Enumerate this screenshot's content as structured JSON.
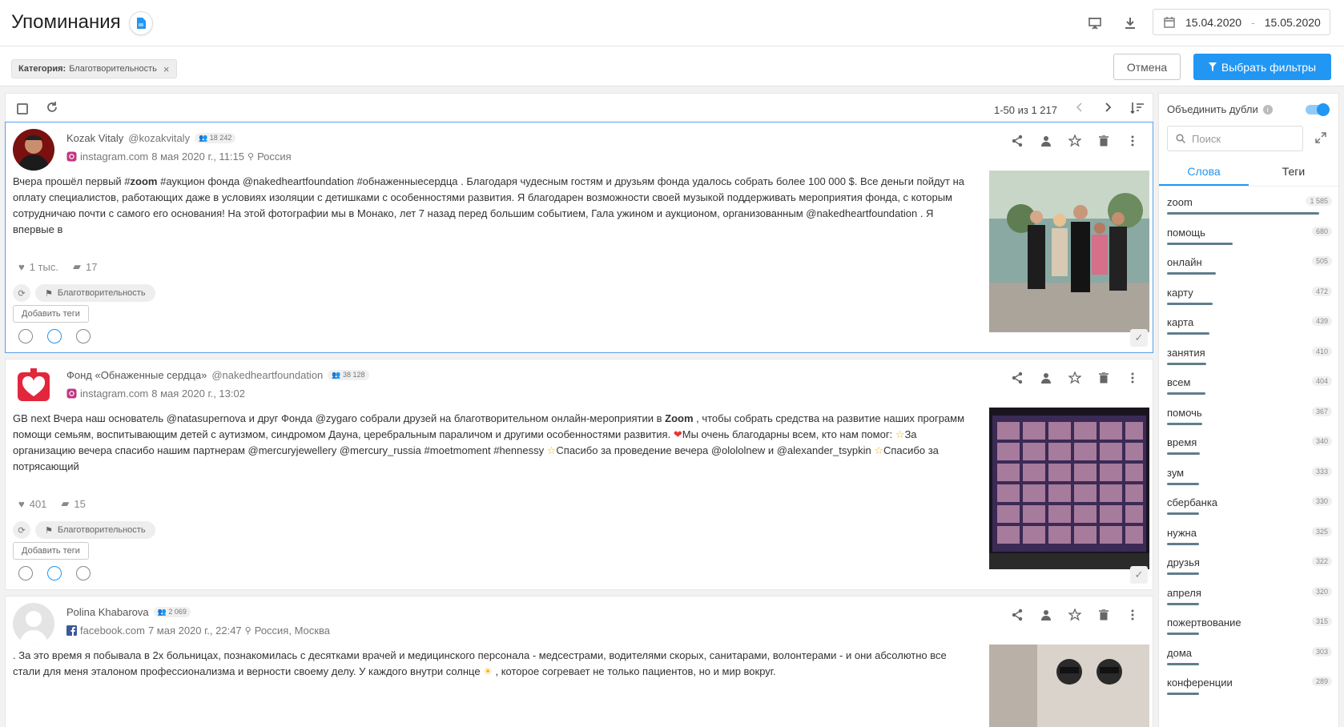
{
  "header": {
    "title": "Упоминания",
    "date_from": "15.04.2020",
    "date_sep": "-",
    "date_to": "15.05.2020"
  },
  "filterbar": {
    "chip_key": "Категория:",
    "chip_value": "Благотворительность",
    "chip_close": "×",
    "cancel_label": "Отмена",
    "filters_label": "Выбрать фильтры"
  },
  "toolbar": {
    "pager_text": "1-50 из 1 217"
  },
  "posts": [
    {
      "author": "Kozak Vitaly",
      "nick": "@kozakvitaly",
      "followers": "18 242",
      "source_icon": "instagram-icon",
      "source": "instagram.com",
      "date": "8 мая 2020 г., 11:15",
      "location": "Россия",
      "text_html": "Вчера прошёл первый #<b>zoom</b> #аукцион фонда @nakedheartfoundation #обнаженныесердца . Благодаря чудесным гостям и друзьям фонда удалось собрать более 100 000 $. Все деньги пойдут на оплату специалистов, работающих даже в условиях изоляции с детишками с особенностями развития. Я благодарен возможности своей музыкой поддерживать мероприятия фонда, с которым сотрудничаю почти с самого его основания! На этой фотографии мы в Монако, лет 7 назад перед большим событием, Гала ужином и аукционом, организованным @nakedheartfoundation . Я впервые в",
      "likes": "1 тыс.",
      "comments": "17",
      "category": "Благотворительность",
      "add_tags": "Добавить теги"
    },
    {
      "author": "Фонд «Обнаженные сердца»",
      "nick": "@nakedheartfoundation",
      "followers": "38 128",
      "source_icon": "instagram-icon",
      "source": "instagram.com",
      "date": "8 мая 2020 г., 13:02",
      "location": "",
      "text_html": "GB next Вчера наш основатель @natasupernova и друг Фонда @zygaro собрали друзей на благотворительном онлайн-мероприятии в <b>Zoom</b> , чтобы собрать средства на развитие наших программ помощи семьям, воспитывающим детей с аутизмом, синдромом Дауна, церебральным параличом и другими особенностями развития. <span style=\"color:#e53935\">❤</span>Мы очень благодарны всем, кто нам помог: <span style=\"color:#f4b400\">☆</span>За организацию вечера спасибо нашим партнерам @mercuryjewellery @mercury_russia #moetmoment #hennessy <span style=\"color:#f4b400\">☆</span>Спасибо за проведение вечера @olololnew и @alexander_tsypkin <span style=\"color:#f4b400\">☆</span>Спасибо за потрясающий",
      "likes": "401",
      "comments": "15",
      "category": "Благотворительность",
      "add_tags": "Добавить теги"
    },
    {
      "author": "Polina Khabarova",
      "nick": "",
      "followers": "2 069",
      "source_icon": "facebook-icon",
      "source": "facebook.com",
      "date": "7 мая 2020 г., 22:47",
      "location": "Россия, Москва",
      "text_html": ". За это время я побывала в 2х больницах, познакомилась с десятками врачей и медицинского персонала - медсестрами, водителями скорых, санитарами, волонтерами - и они абсолютно все стали для меня эталоном профессионализма и верности своему делу. У каждого внутри солнце <span style=\"color:#f4b400\">☀</span> , которое согревает не только пациентов, но и мир вокруг.",
      "likes": "",
      "comments": "",
      "category": "",
      "add_tags": ""
    }
  ],
  "right_panel": {
    "merge_label": "Объединить дубли",
    "search_placeholder": "Поиск",
    "tab_words": "Слова",
    "tab_tags": "Теги",
    "words": [
      {
        "word": "zoom",
        "count": "1 585",
        "value": 1585
      },
      {
        "word": "помощь",
        "count": "680",
        "value": 680
      },
      {
        "word": "онлайн",
        "count": "505",
        "value": 505
      },
      {
        "word": "карту",
        "count": "472",
        "value": 472
      },
      {
        "word": "карта",
        "count": "439",
        "value": 439
      },
      {
        "word": "занятия",
        "count": "410",
        "value": 410
      },
      {
        "word": "всем",
        "count": "404",
        "value": 404
      },
      {
        "word": "помочь",
        "count": "367",
        "value": 367
      },
      {
        "word": "время",
        "count": "340",
        "value": 340
      },
      {
        "word": "зум",
        "count": "333",
        "value": 333
      },
      {
        "word": "сбербанка",
        "count": "330",
        "value": 330
      },
      {
        "word": "нужна",
        "count": "325",
        "value": 325
      },
      {
        "word": "друзья",
        "count": "322",
        "value": 322
      },
      {
        "word": "апреля",
        "count": "320",
        "value": 320
      },
      {
        "word": "пожертвование",
        "count": "315",
        "value": 315
      },
      {
        "word": "дома",
        "count": "303",
        "value": 303
      },
      {
        "word": "конференции",
        "count": "289",
        "value": 289
      }
    ]
  }
}
